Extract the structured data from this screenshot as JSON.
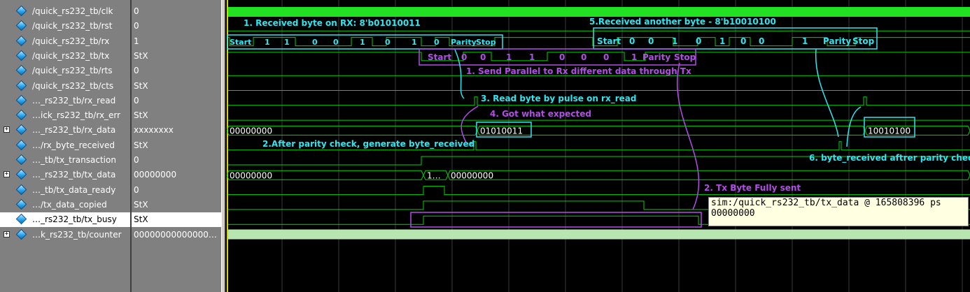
{
  "signals": [
    {
      "name": "/quick_rs232_tb/clk",
      "value": "0",
      "expandable": false
    },
    {
      "name": "/quick_rs232_tb/rst",
      "value": "0",
      "expandable": false
    },
    {
      "name": "/quick_rs232_tb/rx",
      "value": "1",
      "expandable": false
    },
    {
      "name": "/quick_rs232_tb/tx",
      "value": "StX",
      "expandable": false
    },
    {
      "name": "/quick_rs232_tb/rts",
      "value": "0",
      "expandable": false
    },
    {
      "name": "/quick_rs232_tb/cts",
      "value": "StX",
      "expandable": false
    },
    {
      "name": "…_rs232_tb/rx_read",
      "value": "0",
      "expandable": false
    },
    {
      "name": "…ick_rs232_tb/rx_err",
      "value": "StX",
      "expandable": false
    },
    {
      "name": "…_rs232_tb/rx_data",
      "value": "xxxxxxxx",
      "expandable": true
    },
    {
      "name": "…/rx_byte_received",
      "value": "StX",
      "expandable": false
    },
    {
      "name": "…_tb/tx_transaction",
      "value": "0",
      "expandable": false
    },
    {
      "name": "…_rs232_tb/tx_data",
      "value": "00000000",
      "expandable": true
    },
    {
      "name": "…_tb/tx_data_ready",
      "value": "0",
      "expandable": false
    },
    {
      "name": "…/tx_data_copied",
      "value": "StX",
      "expandable": false
    },
    {
      "name": "…_rs232_tb/tx_busy",
      "value": "StX",
      "expandable": false,
      "selected": true
    },
    {
      "name": "…k_rs232_tb/counter",
      "value": "00000000000000…",
      "expandable": true
    }
  ],
  "bus_values": {
    "rx_data_initial": "00000000",
    "rx_data_first": "01010011",
    "rx_data_second": "10010100",
    "tx_data_initial": "00000000",
    "tx_data_mid": "1…",
    "tx_data_after": "00000000"
  },
  "annotations": {
    "a1": "1. Received byte on RX: 8'b01010011",
    "a5": "5.Received another byte - 8'b10010100",
    "send": "1. Send Parallel to Rx different data through Tx",
    "a3": "3. Read byte by pulse on rx_read",
    "a4": "4. Got what expected",
    "a2": "2.After parity check, generate byte_received",
    "a6": "6. byte_received aftrer parity check",
    "tx_sent": "2. Tx Byte Fully sent"
  },
  "rx_frame1": [
    "Start",
    "1",
    "1",
    "0",
    "0",
    "1",
    "0",
    "1",
    "0",
    "Parity",
    "Stop"
  ],
  "rx_frame2": [
    "Start",
    "0",
    "0",
    "1",
    "0",
    "1",
    "0",
    "0",
    "1",
    "Parity",
    "Stop"
  ],
  "tx_frame": [
    "Start",
    "0",
    "0",
    "1",
    "1",
    "0",
    "0",
    "0",
    "1",
    "Parity",
    "Stop"
  ],
  "tooltip": {
    "line1": "sim:/quick_rs232_tb/tx_data @ 165808396 ps",
    "line2": "00000000"
  },
  "colors": {
    "wave": "#00d200",
    "clock_bar": "#22e022",
    "cyan_annot": "#2ee6f0",
    "purple_annot": "#b24ee6",
    "cursor": "#d4d400"
  }
}
